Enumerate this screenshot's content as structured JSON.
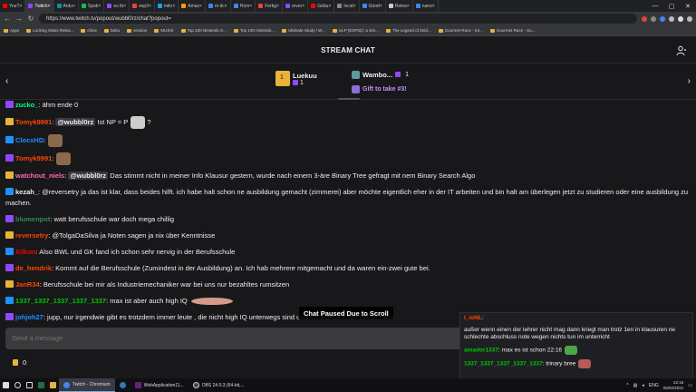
{
  "browser": {
    "tabs": [
      {
        "label": "YouT",
        "color": "#ff0000"
      },
      {
        "label": "Twitch",
        "color": "#9147ff",
        "active": true
      },
      {
        "label": "Ardu",
        "color": "#00979d"
      },
      {
        "label": "Spoti",
        "color": "#1db954"
      },
      {
        "label": "es fü",
        "color": "#9147ff"
      },
      {
        "label": "esp3",
        "color": "#e8453c"
      },
      {
        "label": "mikr",
        "color": "#1da1f2"
      },
      {
        "label": "Amaz",
        "color": "#ff9900"
      },
      {
        "label": "m dc",
        "color": "#4285f4"
      },
      {
        "label": "Hom",
        "color": "#4285f4"
      },
      {
        "label": "Fertig",
        "color": "#e8453c"
      },
      {
        "label": "rever",
        "color": "#9147ff"
      },
      {
        "label": "Gebu",
        "color": "#ff0000"
      },
      {
        "label": "local",
        "color": "#888888"
      },
      {
        "label": "Good",
        "color": "#4285f4"
      },
      {
        "label": "Relea",
        "color": "#cccccc"
      },
      {
        "label": "nano",
        "color": "#4285f4"
      }
    ],
    "url": "https://www.twitch.tv/popout/wubbl0rz/chat?popout=",
    "bookmarks": [
      "Apps",
      "Locking Glass Relea...",
      "chine",
      "bebo",
      "session",
      "MUSIK",
      "Top 100 Nintendo S...",
      "Top 100 nintendo...",
      "Ultimate Study / W...",
      "ULP (ESP32): a sim...",
      "The Legend of Zeld...",
      "Gourmet Race - Kir...",
      "Gourmet Race - Su..."
    ]
  },
  "chat": {
    "title": "STREAM CHAT",
    "leaderboard": {
      "first_name": "Luekuu",
      "first_count": "1",
      "second_name": "Wambo...",
      "second_count": "1",
      "gift_text": "Gift to take #3!"
    },
    "messages": [
      {
        "user": "zucko_",
        "color": "#00ff7f",
        "text": ": ähm ende 0"
      },
      {
        "user": "Tomyk9991",
        "color": "#ff4500",
        "mention": "@wubbl0rz",
        "text": " Ist NP = P",
        "after": " ?"
      },
      {
        "user": "ClocxHD",
        "color": "#1e90ff",
        "text": ":"
      },
      {
        "user": "Tomyk9991",
        "color": "#ff4500",
        "text": ":"
      },
      {
        "user": "watchout_niels",
        "color": "#ff69b4",
        "mention": "@wubbl0rz",
        "text": " Das stimmt nicht in meiner Info Klausur gestern, wurde nach einem 3-äre Binary Tree gefragt mit nem Binary Search Algo"
      },
      {
        "user": "kezah_",
        "color": "#efeff1",
        "text": ": @reversetry ja das ist klar, dass beides hilft. ich habe halt schon ne ausbildung gemacht (zimmerei) aber möchte eigentlich eher in der IT arbeiten und bin halt am überlegen jetzt zu studieren oder eine ausbildung zu machen."
      },
      {
        "user": "blumenpot",
        "color": "#2e8b57",
        "text": ": watt berufsschule war doch mega chillig"
      },
      {
        "user": "reversetry",
        "color": "#ff4500",
        "text": ": @TolgaDaSilva ja Noten sagen ja nix über Kenntnisse"
      },
      {
        "user": "Xilkon",
        "color": "#ff0000",
        "text": ": Also BWL und GK fand ich schon sehr nervig in der Berufsschule"
      },
      {
        "user": "de_hendrik",
        "color": "#ff4500",
        "text": ": Kommt auf die Berufsschule (Zumindest in der Ausbildung) an. Ich hab mehrere mitgemacht und da waren ein-zwei gute bei."
      },
      {
        "user": "JanR34",
        "color": "#ff4500",
        "text": ": Berufsschule bei mir als Industriemechaniker war bei uns nur bezahltes rumsitzen"
      },
      {
        "user": "1337_1337_1337_1337_1337",
        "color": "#00c800",
        "text": ": max ist aber auch high IQ"
      },
      {
        "user": "johjoh27",
        "color": "#1e90ff",
        "text": ": jupp, nur irgendwie gibt es trotzdem immer leute , die nicht high IQ unterwegs sind und nix auf die kette bekommen"
      }
    ],
    "paused_label": "Chat Paused Due to Scroll",
    "input_placeholder": "Send a message",
    "points": "0"
  },
  "popout": {
    "messages": [
      {
        "user": "l_ioNL",
        "color": "#ff4500",
        "text": ":"
      },
      {
        "user": "",
        "color": "#efeff1",
        "text": "außer wenn einen der lehrer nicht mag dann kriegt man trotz 1en in klausuren ne schlechte abschluss note wegen nichts tun im unterricht"
      },
      {
        "user": "amador1337",
        "color": "#00c800",
        "text": ": max es ist schon 22:16"
      },
      {
        "user": "1337_1337_1337_1337_1337",
        "color": "#00c800",
        "text": ": trinary bree"
      }
    ]
  },
  "taskbar": {
    "apps": [
      "Twitch - Chromium",
      "WebApplication11...",
      "OBS 24.0.3 (64-bit,..."
    ],
    "lang": "ENG",
    "time": "22:16",
    "date": "05/02/2021"
  }
}
